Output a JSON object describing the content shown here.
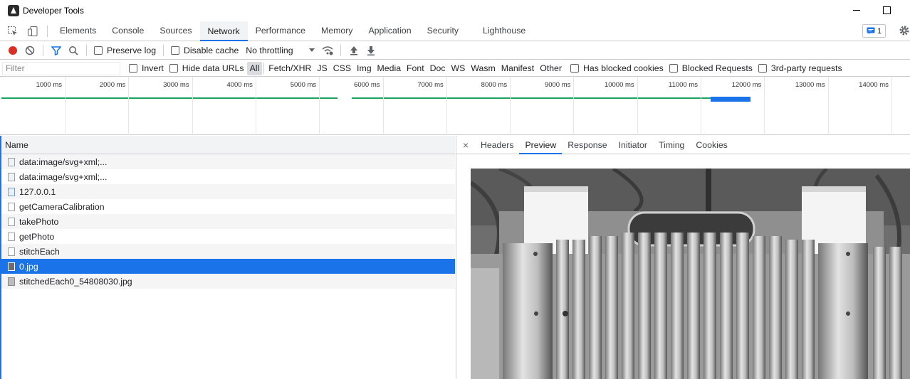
{
  "window": {
    "title": "Developer Tools"
  },
  "tabs": [
    "Elements",
    "Console",
    "Sources",
    "Network",
    "Performance",
    "Memory",
    "Application",
    "Security",
    "Lighthouse"
  ],
  "active_tab": "Network",
  "issues": {
    "count": "1"
  },
  "toolbar": {
    "preserve_log": "Preserve log",
    "disable_cache": "Disable cache",
    "throttling": "No throttling"
  },
  "filter": {
    "placeholder": "Filter",
    "invert": "Invert",
    "hide_data_urls": "Hide data URLs",
    "types": [
      "All",
      "Fetch/XHR",
      "JS",
      "CSS",
      "Img",
      "Media",
      "Font",
      "Doc",
      "WS",
      "Wasm",
      "Manifest",
      "Other"
    ],
    "has_blocked_cookies": "Has blocked cookies",
    "blocked_requests": "Blocked Requests",
    "third_party": "3rd-party requests"
  },
  "overview": {
    "ticks": [
      "1000 ms",
      "2000 ms",
      "3000 ms",
      "4000 ms",
      "5000 ms",
      "6000 ms",
      "7000 ms",
      "8000 ms",
      "9000 ms",
      "10000 ms",
      "11000 ms",
      "12000 ms",
      "13000 ms",
      "14000 ms"
    ]
  },
  "requests": {
    "header": "Name",
    "rows": [
      {
        "name": "data:image/svg+xml;...",
        "type": "svg"
      },
      {
        "name": "data:image/svg+xml;...",
        "type": "svg"
      },
      {
        "name": "127.0.0.1",
        "type": "doc"
      },
      {
        "name": "getCameraCalibration",
        "type": "xhr"
      },
      {
        "name": "takePhoto",
        "type": "xhr"
      },
      {
        "name": "getPhoto",
        "type": "xhr"
      },
      {
        "name": "stitchEach",
        "type": "xhr"
      },
      {
        "name": "0.jpg",
        "type": "img",
        "selected": true
      },
      {
        "name": "stitchedEach0_54808030.jpg",
        "type": "img"
      }
    ]
  },
  "details": {
    "close": "×",
    "tabs": [
      "Headers",
      "Preview",
      "Response",
      "Initiator",
      "Timing",
      "Cookies"
    ],
    "active": "Preview"
  }
}
